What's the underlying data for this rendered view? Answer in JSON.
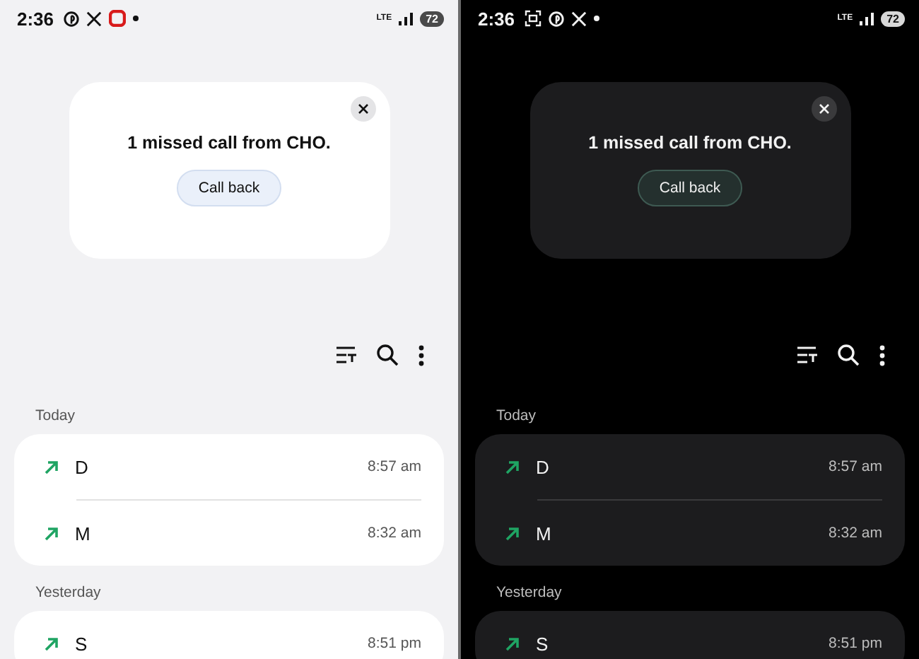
{
  "screens": [
    {
      "kind": "light",
      "status_bar": {
        "time": "2:36",
        "status_icons": [
          {
            "kind": "pinterest"
          },
          {
            "kind": "x"
          },
          {
            "kind": "app"
          },
          {
            "kind": "dot"
          }
        ],
        "network": "LTE",
        "battery": "72"
      },
      "notification": {
        "message": "1 missed call from CHO.",
        "action": "Call back"
      },
      "sections": [
        {
          "title": "Today",
          "calls": [
            {
              "name": "D",
              "time": "8:57 am",
              "kind": "outgoing"
            },
            {
              "name": "M",
              "time": "8:32 am",
              "kind": "outgoing"
            }
          ]
        },
        {
          "title": "Yesterday",
          "calls": [
            {
              "name": "S",
              "time": "8:51 pm",
              "kind": "outgoing"
            }
          ]
        }
      ]
    },
    {
      "kind": "dark",
      "status_bar": {
        "time": "2:36",
        "status_icons": [
          {
            "kind": "screenshot"
          },
          {
            "kind": "pinterest"
          },
          {
            "kind": "x"
          },
          {
            "kind": "dot"
          }
        ],
        "network": "LTE",
        "battery": "72"
      },
      "notification": {
        "message": "1 missed call from CHO.",
        "action": "Call back"
      },
      "sections": [
        {
          "title": "Today",
          "calls": [
            {
              "name": "D",
              "time": "8:57 am",
              "kind": "outgoing"
            },
            {
              "name": "M",
              "time": "8:32 am",
              "kind": "outgoing"
            }
          ]
        },
        {
          "title": "Yesterday",
          "calls": [
            {
              "name": "S",
              "time": "8:51 pm",
              "kind": "outgoing"
            }
          ]
        }
      ]
    }
  ]
}
